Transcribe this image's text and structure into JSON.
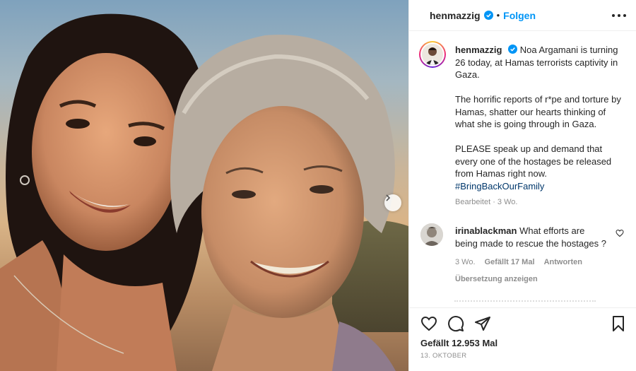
{
  "post": {
    "username": "henmazzig",
    "follow_label": "Folgen",
    "separator": "•",
    "caption": {
      "line1": "Noa Argamani is turning 26 today, at Hamas terrorists captivity in Gaza.",
      "line2": "The horrific reports of r*pe and torture by Hamas, shatter our hearts thinking of what she is going through in Gaza.",
      "line3": "PLEASE speak up and demand that every one of the hostages be released from Hamas right now.",
      "hashtag": "#BringBackOurFamily",
      "edited": "Bearbeitet · 3 Wo."
    },
    "comment": {
      "username": "irinablackman",
      "text": "What efforts are being made to rescue the hostages ?",
      "age": "3 Wo.",
      "likes": "Gefällt 17 Mal",
      "reply": "Antworten",
      "translate": "Übersetzung anzeigen"
    },
    "likes": "Gefällt 12.953 Mal",
    "date": "13. OKTOBER"
  },
  "icons": {
    "verified": "verified-badge-icon",
    "more": "more-options-icon",
    "like": "heart-icon",
    "comment": "comment-icon",
    "share": "share-icon",
    "save": "bookmark-icon",
    "next": "chevron-right-icon"
  },
  "colors": {
    "accent_blue": "#0095f6",
    "hashtag": "#00376b",
    "muted": "#8e8e8e",
    "text": "#262626"
  }
}
